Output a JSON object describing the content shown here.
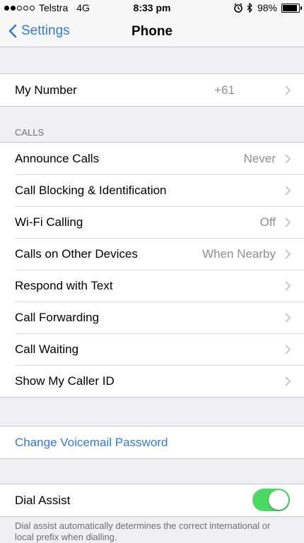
{
  "status_bar": {
    "carrier": "Telstra",
    "network": "4G",
    "time": "8:33 pm",
    "battery": "98%",
    "battery_level": 0.98,
    "signal_bars_filled": 2,
    "signal_bars_total": 5,
    "icons": [
      "alarm-icon",
      "bluetooth-icon",
      "battery-icon"
    ]
  },
  "nav": {
    "back_label": "Settings",
    "title": "Phone"
  },
  "my_number": {
    "label": "My Number",
    "value": "+61"
  },
  "calls_section": {
    "header": "CALLS",
    "rows": [
      {
        "label": "Announce Calls",
        "value": "Never"
      },
      {
        "label": "Call Blocking & Identification",
        "value": ""
      },
      {
        "label": "Wi-Fi Calling",
        "value": "Off"
      },
      {
        "label": "Calls on Other Devices",
        "value": "When Nearby"
      },
      {
        "label": "Respond with Text",
        "value": ""
      },
      {
        "label": "Call Forwarding",
        "value": ""
      },
      {
        "label": "Call Waiting",
        "value": ""
      },
      {
        "label": "Show My Caller ID",
        "value": ""
      }
    ]
  },
  "voicemail": {
    "label": "Change Voicemail Password"
  },
  "dial_assist": {
    "label": "Dial Assist",
    "enabled": true,
    "footer": "Dial assist automatically determines the correct international or local prefix when dialling."
  },
  "colors": {
    "accent": "#2f7bd8",
    "toggle_on": "#4cd964",
    "background": "#efeff4",
    "secondary_text": "#8e8e93"
  }
}
